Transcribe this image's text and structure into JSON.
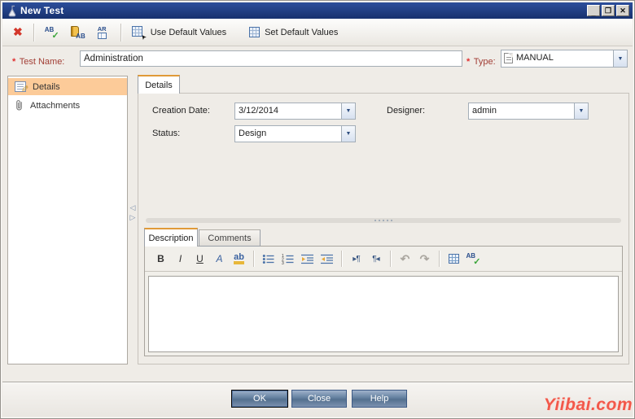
{
  "window": {
    "title": "New Test"
  },
  "icons": {
    "minimize": "_",
    "maximize": "❐",
    "close": "✕",
    "dropdown": "▼",
    "star": "*",
    "clear_x": "✖",
    "ab": "AB",
    "ar": "AR",
    "check": "✓",
    "cursor": "➤",
    "collapse_left": "◁",
    "collapse_right": "▷",
    "bold": "B",
    "italic": "I",
    "underline": "U",
    "font_color": "A",
    "highlight": "ab",
    "ltr": "▸¶",
    "rtl": "¶◂",
    "undo": "↶",
    "redo": "↷"
  },
  "toolbar": {
    "use_default_values": "Use Default Values",
    "set_default_values": "Set Default Values"
  },
  "header_fields": {
    "test_name": {
      "label": "Test Name:",
      "value": "Administration"
    },
    "type": {
      "label": "Type:",
      "value": "MANUAL"
    }
  },
  "sidebar": {
    "items": [
      {
        "label": "Details",
        "selected": true
      },
      {
        "label": "Attachments",
        "selected": false
      }
    ]
  },
  "main": {
    "details_tab": "Details",
    "fields": {
      "creation_date": {
        "label": "Creation Date:",
        "value": "3/12/2014"
      },
      "designer": {
        "label": "Designer:",
        "value": "admin"
      },
      "status": {
        "label": "Status:",
        "value": "Design"
      }
    }
  },
  "editor": {
    "tabs": {
      "description": "Description",
      "comments": "Comments"
    },
    "content": ""
  },
  "footer": {
    "ok": "OK",
    "close": "Close",
    "help": "Help"
  },
  "watermark": "Yiibai.com",
  "colors": {
    "titlebar": "#1B3C86",
    "selection": "#FCCB99",
    "tab_accent": "#E09A38",
    "required_label": "#A23E35",
    "button_blue": "#63809F"
  }
}
